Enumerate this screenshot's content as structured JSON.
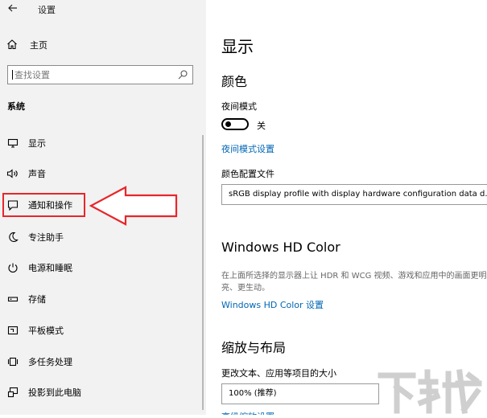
{
  "window": {
    "title": "设置"
  },
  "sidebar": {
    "home_label": "主页",
    "search_placeholder": "查找设置",
    "section_title": "系统",
    "items": [
      {
        "label": "显示",
        "icon": "monitor-icon"
      },
      {
        "label": "声音",
        "icon": "speaker-icon"
      },
      {
        "label": "通知和操作",
        "icon": "notification-icon"
      },
      {
        "label": "专注助手",
        "icon": "moon-icon"
      },
      {
        "label": "电源和睡眠",
        "icon": "power-icon"
      },
      {
        "label": "存储",
        "icon": "storage-icon"
      },
      {
        "label": "平板模式",
        "icon": "tablet-icon"
      },
      {
        "label": "多任务处理",
        "icon": "multitask-icon"
      },
      {
        "label": "投影到此电脑",
        "icon": "project-icon"
      }
    ]
  },
  "annotation": {
    "highlight_color": "#e8262b"
  },
  "main": {
    "page_title": "显示",
    "color_section": {
      "title": "颜色",
      "night_mode_label": "夜间模式",
      "night_mode_state": "关",
      "night_mode_link": "夜间模式设置",
      "color_profile_label": "颜色配置文件",
      "color_profile_value": "sRGB display profile with display hardware configuration data d..."
    },
    "hd_section": {
      "title": "Windows HD Color",
      "description": "在上面所选择的显示器上让 HDR 和 WCG 视频、游戏和应用中的画面更明亮、更生动。",
      "link": "Windows HD Color 设置"
    },
    "scale_section": {
      "title": "缩放与布局",
      "text_size_label": "更改文本、应用等项目的大小",
      "text_size_value": "100% (推荐)",
      "advanced_link": "高级缩放设置"
    }
  },
  "colors": {
    "accent": "#0066b4",
    "sidebar_bg": "#f2f2f2"
  }
}
